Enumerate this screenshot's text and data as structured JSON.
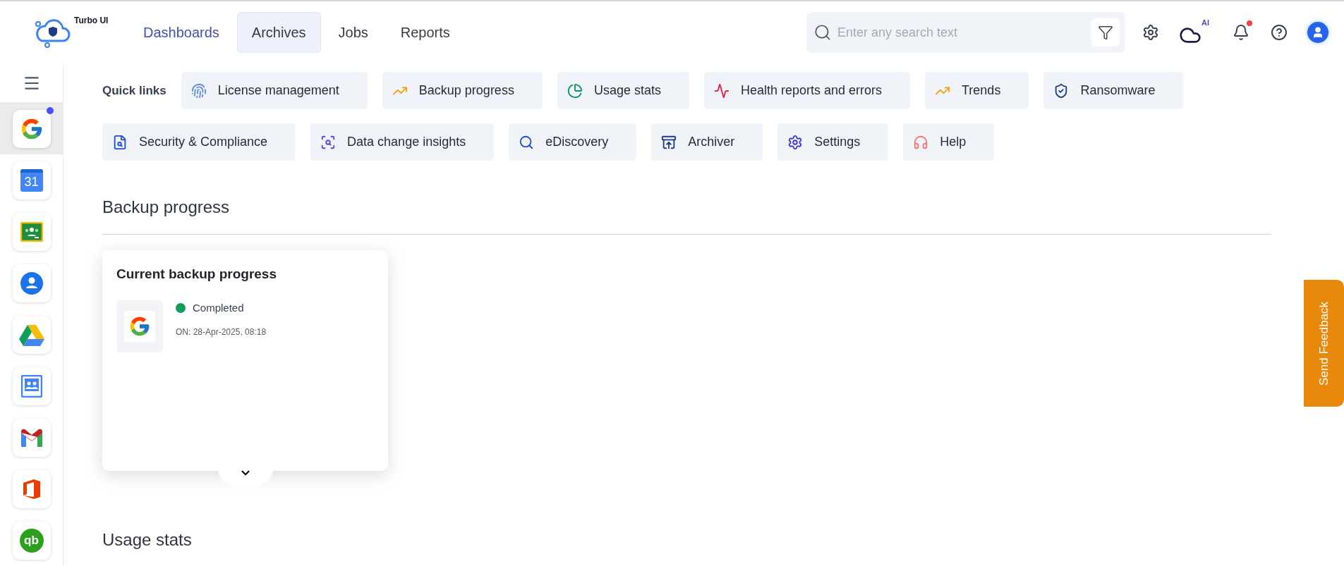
{
  "logo": {
    "text": "Turbo UI"
  },
  "nav": [
    {
      "label": "Dashboards",
      "selected": true,
      "hovered": false
    },
    {
      "label": "Archives",
      "selected": false,
      "hovered": true
    },
    {
      "label": "Jobs",
      "selected": false,
      "hovered": false
    },
    {
      "label": "Reports",
      "selected": false,
      "hovered": false
    }
  ],
  "search": {
    "placeholder": "Enter any search text"
  },
  "toolbar": {
    "ai_label": "AI",
    "notifications_alert": true
  },
  "sidebar": {
    "apps": [
      {
        "kind": "google",
        "selected": true,
        "badge": true
      },
      {
        "kind": "calendar",
        "label": "31",
        "selected": false,
        "badge": false
      },
      {
        "kind": "classroom",
        "selected": false,
        "badge": false
      },
      {
        "kind": "contacts",
        "selected": false,
        "badge": false
      },
      {
        "kind": "drive",
        "selected": false,
        "badge": false
      },
      {
        "kind": "groups",
        "selected": false,
        "badge": false
      },
      {
        "kind": "gmail",
        "selected": false,
        "badge": false
      },
      {
        "kind": "office",
        "selected": false,
        "badge": false
      },
      {
        "kind": "quickbooks",
        "label": "qb",
        "selected": false,
        "badge": false
      }
    ]
  },
  "quick_links": {
    "title": "Quick links",
    "items": [
      {
        "label": "License management",
        "kind": "fingerprint"
      },
      {
        "label": "Backup progress",
        "kind": "trend"
      },
      {
        "label": "Usage stats",
        "kind": "pie"
      },
      {
        "label": "Health reports and errors",
        "kind": "pulse"
      },
      {
        "label": "Trends",
        "kind": "trend"
      },
      {
        "label": "Ransomware",
        "kind": "shield"
      },
      {
        "label": "Security & Compliance",
        "kind": "document"
      },
      {
        "label": "Data change insights",
        "kind": "scan"
      },
      {
        "label": "eDiscovery",
        "kind": "search"
      },
      {
        "label": "Archiver",
        "kind": "archive"
      },
      {
        "label": "Settings",
        "kind": "gear"
      },
      {
        "label": "Help",
        "kind": "headphones"
      }
    ]
  },
  "sections": [
    {
      "title": "Backup progress",
      "card": {
        "title": "Current backup progress",
        "items": [
          {
            "status": "Completed",
            "color": "#0f9d58",
            "date": "ON: 28-Apr-2025, 08:18"
          }
        ]
      }
    },
    {
      "title": "Usage stats"
    }
  ],
  "feedback": {
    "label": "Send Feedback"
  }
}
